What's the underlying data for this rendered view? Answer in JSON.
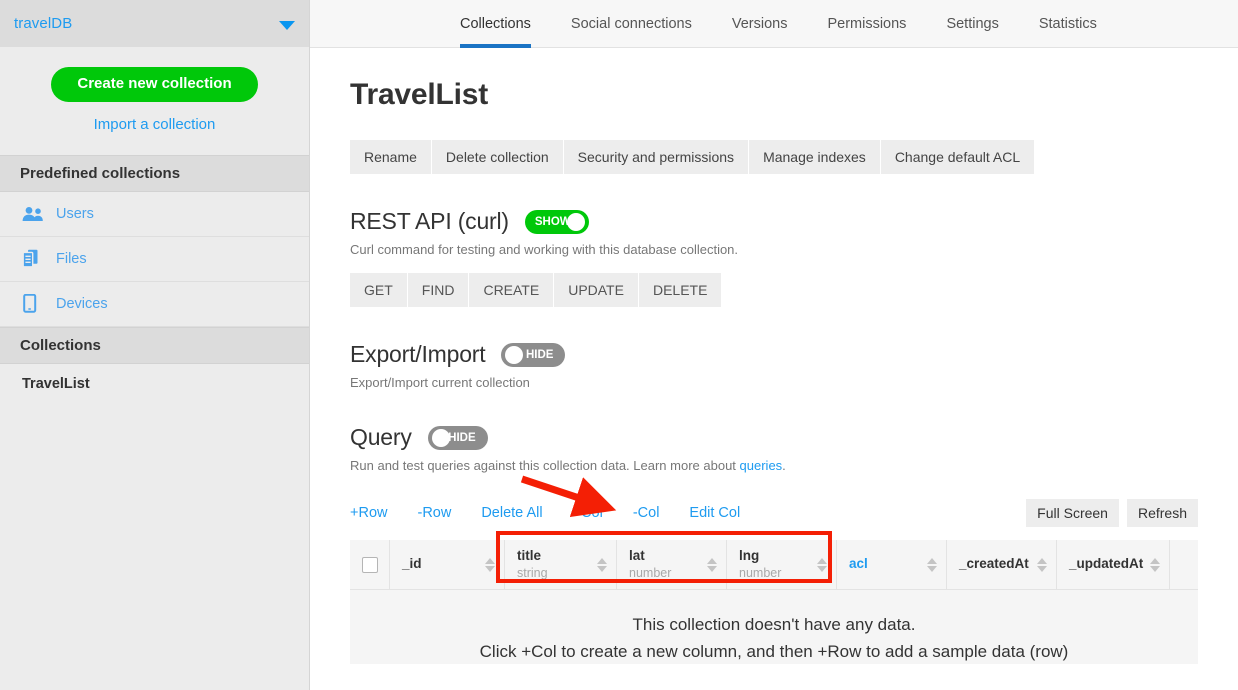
{
  "sidebar": {
    "database_name": "travelDB",
    "dropdown_icon": "caret-down-icon",
    "create_button": "Create new collection",
    "import_link": "Import a collection",
    "predefined_header": "Predefined collections",
    "predefined_items": [
      {
        "label": "Users",
        "icon": "users-icon"
      },
      {
        "label": "Files",
        "icon": "files-icon"
      },
      {
        "label": "Devices",
        "icon": "device-icon"
      }
    ],
    "collections_header": "Collections",
    "collections": [
      {
        "label": "TravelList"
      }
    ]
  },
  "topnav": {
    "tabs": [
      {
        "label": "Collections",
        "active": true
      },
      {
        "label": "Social connections",
        "active": false
      },
      {
        "label": "Versions",
        "active": false
      },
      {
        "label": "Permissions",
        "active": false
      },
      {
        "label": "Settings",
        "active": false
      },
      {
        "label": "Statistics",
        "active": false
      }
    ]
  },
  "page": {
    "title": "TravelList",
    "action_buttons": [
      "Rename",
      "Delete collection",
      "Security and permissions",
      "Manage indexes",
      "Change default ACL"
    ]
  },
  "rest_api": {
    "title": "REST API (curl)",
    "toggle_label": "SHOW",
    "toggle_state": "on",
    "description": "Curl command for testing and working with this database collection.",
    "verbs": [
      "GET",
      "FIND",
      "CREATE",
      "UPDATE",
      "DELETE"
    ]
  },
  "export_import": {
    "title": "Export/Import",
    "toggle_label": "HIDE",
    "toggle_state": "off",
    "description": "Export/Import current collection"
  },
  "query": {
    "title": "Query",
    "toggle_label": "HIDE",
    "toggle_state": "off",
    "description_prefix": "Run and test queries against this collection data. Learn more about ",
    "description_link": "queries",
    "description_suffix": ".",
    "toolbar": [
      "+Row",
      "-Row",
      "Delete All",
      "+Col",
      "-Col",
      "Edit Col"
    ],
    "right_buttons": [
      "Full Screen",
      "Refresh"
    ]
  },
  "table": {
    "select_all_checkbox": "unchecked",
    "columns": [
      {
        "name": "_id",
        "type": "",
        "accent": false,
        "sortable": true
      },
      {
        "name": "title",
        "type": "string",
        "accent": false,
        "sortable": true
      },
      {
        "name": "lat",
        "type": "number",
        "accent": false,
        "sortable": true
      },
      {
        "name": "lng",
        "type": "number",
        "accent": false,
        "sortable": true
      },
      {
        "name": "acl",
        "type": "",
        "accent": true,
        "sortable": true
      },
      {
        "name": "_createdAt",
        "type": "",
        "accent": false,
        "sortable": true
      },
      {
        "name": "_updatedAt",
        "type": "",
        "accent": false,
        "sortable": true
      }
    ],
    "empty_line_1": "This collection doesn't have any data.",
    "empty_line_2": "Click +Col to create a new column, and then +Row to add a sample data (row)"
  },
  "annotations": {
    "arrow_color": "#f41f05",
    "highlight_color": "#f41f05",
    "arrow_target": "+Col",
    "highlight_target": "new columns title / lat / lng"
  },
  "colors": {
    "accent_blue": "#1e9bf0",
    "tab_underline": "#1a73c4",
    "green": "#00c80a",
    "sidebar_bg": "#ececec",
    "header_bg": "#dcdcdc"
  }
}
